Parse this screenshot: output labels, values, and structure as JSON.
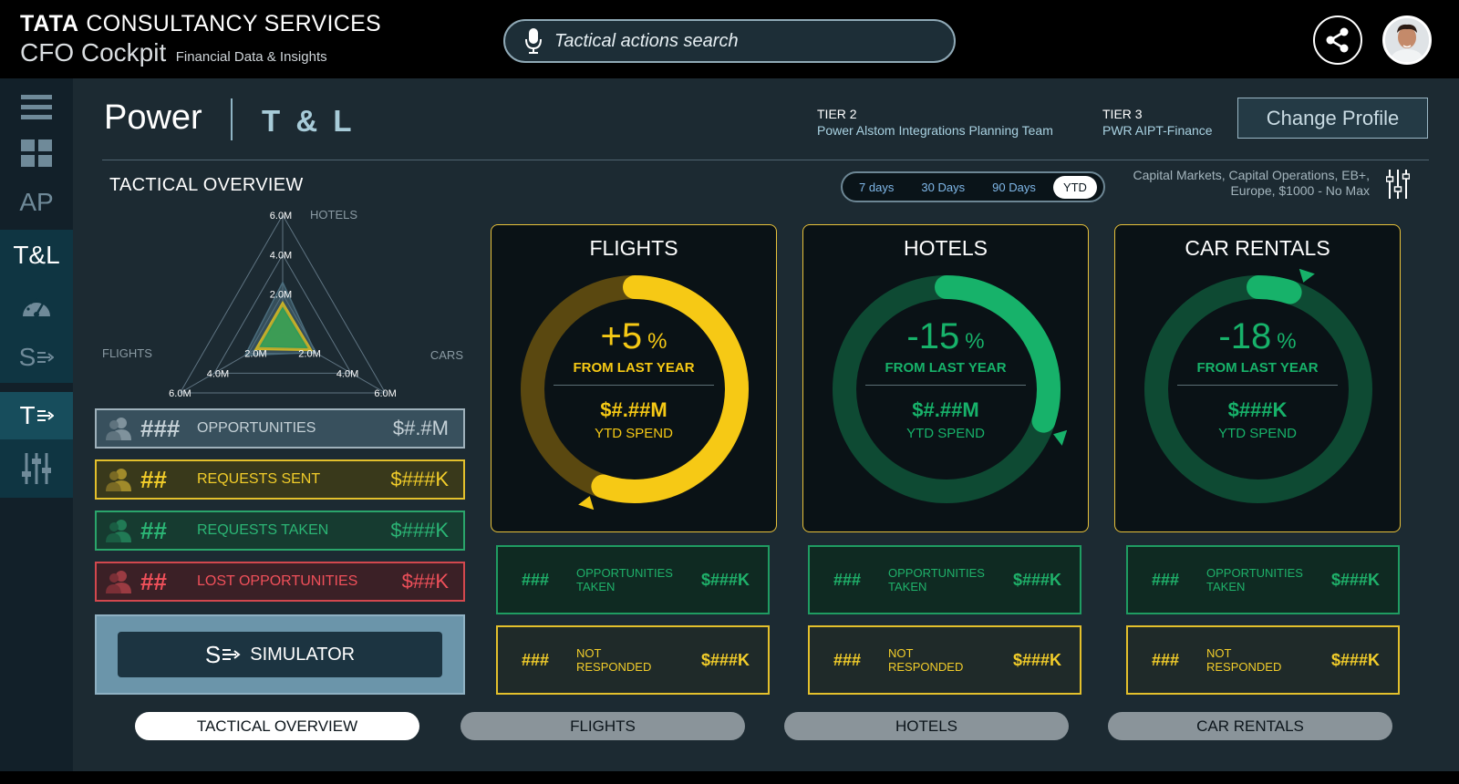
{
  "header": {
    "brand_tata": "TATA",
    "brand_company": "CONSULTANCY SERVICES",
    "app_title": "CFO Cockpit",
    "app_subtitle": "Financial Data & Insights",
    "search_placeholder": "Tactical actions search",
    "icons": {
      "search": "microphone-icon",
      "share": "share-icon",
      "avatar": "user-avatar"
    }
  },
  "sidebar": {
    "items": [
      {
        "icon": "menu-icon"
      },
      {
        "icon": "grid-icon"
      },
      {
        "label": "AP"
      },
      {
        "label": "T&L",
        "state": "current"
      },
      {
        "icon": "gauge-icon"
      },
      {
        "label": "S",
        "icon": "simulator-icon"
      },
      {
        "label": "T",
        "icon": "tactical-icon",
        "state": "active"
      },
      {
        "icon": "sliders-icon"
      }
    ]
  },
  "page": {
    "title": "Power",
    "subtitle": "T & L",
    "tier2_label": "TIER 2",
    "tier2_value": "Power Alstom Integrations Planning Team",
    "tier3_label": "TIER 3",
    "tier3_value": "PWR AIPT-Finance",
    "change_profile": "Change Profile"
  },
  "overview": {
    "title": "TACTICAL OVERVIEW",
    "range_options": [
      "7 days",
      "30 Days",
      "90 Days",
      "YTD"
    ],
    "range_selected": "YTD",
    "filters_line1": "Capital Markets, Capital Operations, EB+,",
    "filters_line2": "Europe, $1000 - No Max"
  },
  "chart_data": {
    "type": "radar",
    "axes": [
      "HOTELS",
      "CARS",
      "FLIGHTS"
    ],
    "ticks": [
      "2.0M",
      "4.0M",
      "6.0M"
    ],
    "max": 6.0,
    "series": [
      {
        "values": [
          2.6,
          1.9,
          2.2
        ],
        "color": "#4a6c7c"
      },
      {
        "values": [
          1.6,
          1.7,
          1.6
        ],
        "color": "#c9b328"
      },
      {
        "values": [
          1.3,
          1.4,
          1.3
        ],
        "color": "#2f9a5a"
      }
    ]
  },
  "stats": [
    {
      "count": "###",
      "label": "OPPORTUNITIES",
      "amount": "$#.#M"
    },
    {
      "count": "##",
      "label": "REQUESTS SENT",
      "amount": "$###K"
    },
    {
      "count": "##",
      "label": "REQUESTS TAKEN",
      "amount": "$###K"
    },
    {
      "count": "##",
      "label": "LOST OPPORTUNITIES",
      "amount": "$##K"
    }
  ],
  "simulator_label": "SIMULATOR",
  "cards": [
    {
      "title": "FLIGHTS",
      "pct": "+5",
      "pct_sym": "%",
      "from": "FROM LAST YEAR",
      "spend": "$#.##M",
      "ytd": "YTD SPEND",
      "progress": 0.55,
      "color": "#f6c915",
      "track": "#5a4810",
      "opp_count": "###",
      "opp_label_1": "OPPORTUNITIES",
      "opp_label_2": "TAKEN",
      "opp_amt": "$###K",
      "nr_count": "###",
      "nr_label_1": "NOT",
      "nr_label_2": "RESPONDED",
      "nr_amt": "$###K"
    },
    {
      "title": "HOTELS",
      "pct": "-15",
      "pct_sym": "%",
      "from": "FROM LAST YEAR",
      "spend": "$#.##M",
      "ytd": "YTD SPEND",
      "progress": 0.3,
      "color": "#17b26a",
      "track": "#0e4a33",
      "opp_count": "###",
      "opp_label_1": "OPPORTUNITIES",
      "opp_label_2": "TAKEN",
      "opp_amt": "$###K",
      "nr_count": "###",
      "nr_label_1": "NOT",
      "nr_label_2": "RESPONDED",
      "nr_amt": "$###K"
    },
    {
      "title": "CAR RENTALS",
      "pct": "-18",
      "pct_sym": "%",
      "from": "FROM LAST YEAR",
      "spend": "$###K",
      "ytd": "YTD SPEND",
      "progress": 0.05,
      "color": "#17b26a",
      "track": "#0e4a33",
      "opp_count": "###",
      "opp_label_1": "OPPORTUNITIES",
      "opp_label_2": "TAKEN",
      "opp_amt": "$###K",
      "nr_count": "###",
      "nr_label_1": "NOT",
      "nr_label_2": "RESPONDED",
      "nr_amt": "$###K"
    }
  ],
  "tabs": [
    "TACTICAL OVERVIEW",
    "FLIGHTS",
    "HOTELS",
    "CAR RENTALS"
  ],
  "tab_selected": "TACTICAL OVERVIEW"
}
